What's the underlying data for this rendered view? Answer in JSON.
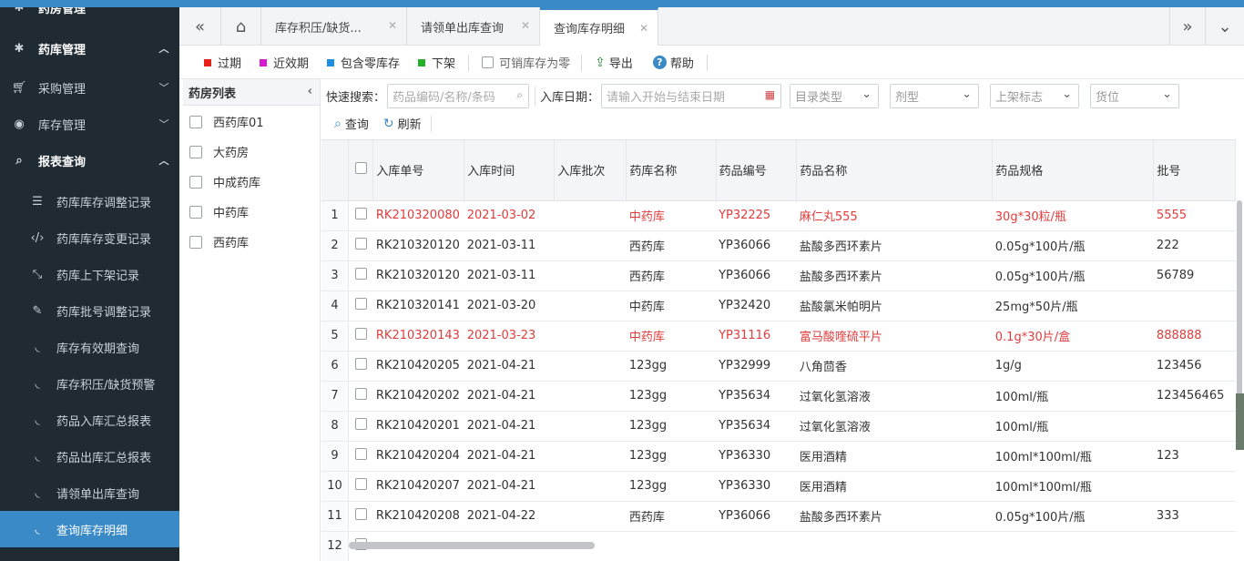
{
  "colors": {
    "accent": "#3a8ac8",
    "sidebar_bg": "#1f2a33",
    "red": "#e03c3c"
  },
  "sidebar": {
    "partial_top": {
      "label": "药房管理",
      "icon": "gear-icon"
    },
    "pharmacy": {
      "label": "药库管理",
      "icon": "gear-icon"
    },
    "purchase": {
      "label": "采购管理",
      "icon": "cart-icon"
    },
    "inventory": {
      "label": "库存管理",
      "icon": "compass-icon"
    },
    "reports": {
      "label": "报表查询",
      "icon": "search-icon"
    },
    "items": [
      {
        "label": "药库库存调整记录",
        "icon": "sliders-icon"
      },
      {
        "label": "药库库存变更记录",
        "icon": "code-icon"
      },
      {
        "label": "药库上下架记录",
        "icon": "expand-icon"
      },
      {
        "label": "药库批号调整记录",
        "icon": "edit-icon"
      },
      {
        "label": "库存有效期查询",
        "icon": "rss-icon"
      },
      {
        "label": "库存积压/缺货预警",
        "icon": "rss-icon"
      },
      {
        "label": "药品入库汇总报表",
        "icon": "rss-icon"
      },
      {
        "label": "药品出库汇总报表",
        "icon": "rss-icon"
      },
      {
        "label": "请领单出库查询",
        "icon": "rss-icon"
      },
      {
        "label": "查询库存明细",
        "icon": "rss-icon"
      }
    ]
  },
  "tabs": [
    {
      "label": "库存积压/缺货..."
    },
    {
      "label": "请领单出库查询"
    },
    {
      "label": "查询库存明细"
    }
  ],
  "toolbar": {
    "expired": "过期",
    "near_expiry": "近效期",
    "include_zero": "包含零库存",
    "off_shelf": "下架",
    "sellable_zero": "可销库存为零",
    "export": "导出",
    "help": "帮助"
  },
  "pharmacy_list": {
    "title": "药房列表",
    "items": [
      "西药库01",
      "大药房",
      "中成药库",
      "中药库",
      "西药库"
    ]
  },
  "search": {
    "quick_label": "快速搜索：",
    "quick_placeholder": "药品编码/名称/条码",
    "date_label": "入库日期：",
    "date_placeholder": "请输入开始与结束日期",
    "catalog_type": "目录类型",
    "dosage": "剂型",
    "shelf_flag": "上架标志",
    "location": "货位",
    "query": "查询",
    "refresh": "刷新"
  },
  "table": {
    "headers": [
      "入库单号",
      "入库时间",
      "入库批次",
      "药库名称",
      "药品编号",
      "药品名称",
      "药品规格",
      "批号"
    ],
    "rows": [
      {
        "n": "1",
        "id": "RK210320080",
        "date": "2021-03-02",
        "batch": "",
        "store": "中药库",
        "code": "YP32225",
        "name": "麻仁丸555",
        "spec": "30g*30粒/瓶",
        "lot": "5555",
        "red": true
      },
      {
        "n": "2",
        "id": "RK210320120",
        "date": "2021-03-11",
        "batch": "",
        "store": "西药库",
        "code": "YP36066",
        "name": "盐酸多西环素片",
        "spec": "0.05g*100片/瓶",
        "lot": "222",
        "red": false
      },
      {
        "n": "3",
        "id": "RK210320120",
        "date": "2021-03-11",
        "batch": "",
        "store": "西药库",
        "code": "YP36066",
        "name": "盐酸多西环素片",
        "spec": "0.05g*100片/瓶",
        "lot": "56789",
        "red": false
      },
      {
        "n": "4",
        "id": "RK210320141",
        "date": "2021-03-20",
        "batch": "",
        "store": "中药库",
        "code": "YP32420",
        "name": "盐酸氯米帕明片",
        "spec": "25mg*50片/瓶",
        "lot": "",
        "red": false
      },
      {
        "n": "5",
        "id": "RK210320143",
        "date": "2021-03-23",
        "batch": "",
        "store": "中药库",
        "code": "YP31116",
        "name": "富马酸喹硫平片",
        "spec": "0.1g*30片/盒",
        "lot": "888888",
        "red": true
      },
      {
        "n": "6",
        "id": "RK210420205",
        "date": "2021-04-21",
        "batch": "",
        "store": "123gg",
        "code": "YP32999",
        "name": "八角茴香",
        "spec": "1g/g",
        "lot": "123456",
        "red": false
      },
      {
        "n": "7",
        "id": "RK210420202",
        "date": "2021-04-21",
        "batch": "",
        "store": "123gg",
        "code": "YP35634",
        "name": "过氧化氢溶液",
        "spec": "100ml/瓶",
        "lot": "123456465",
        "red": false
      },
      {
        "n": "8",
        "id": "RK210420201",
        "date": "2021-04-21",
        "batch": "",
        "store": "123gg",
        "code": "YP35634",
        "name": "过氧化氢溶液",
        "spec": "100ml/瓶",
        "lot": "",
        "red": false
      },
      {
        "n": "9",
        "id": "RK210420204",
        "date": "2021-04-21",
        "batch": "",
        "store": "123gg",
        "code": "YP36330",
        "name": "医用酒精",
        "spec": "100ml*100ml/瓶",
        "lot": "123",
        "red": false
      },
      {
        "n": "10",
        "id": "RK210420207",
        "date": "2021-04-21",
        "batch": "",
        "store": "123gg",
        "code": "YP36330",
        "name": "医用酒精",
        "spec": "100ml*100ml/瓶",
        "lot": "",
        "red": false
      },
      {
        "n": "11",
        "id": "RK210420208",
        "date": "2021-04-22",
        "batch": "",
        "store": "西药库",
        "code": "YP36066",
        "name": "盐酸多西环素片",
        "spec": "0.05g*100片/瓶",
        "lot": "333",
        "red": false
      },
      {
        "n": "12",
        "id": "",
        "date": "",
        "batch": "",
        "store": "",
        "code": "",
        "name": "",
        "spec": "",
        "lot": "",
        "red": false
      }
    ]
  }
}
